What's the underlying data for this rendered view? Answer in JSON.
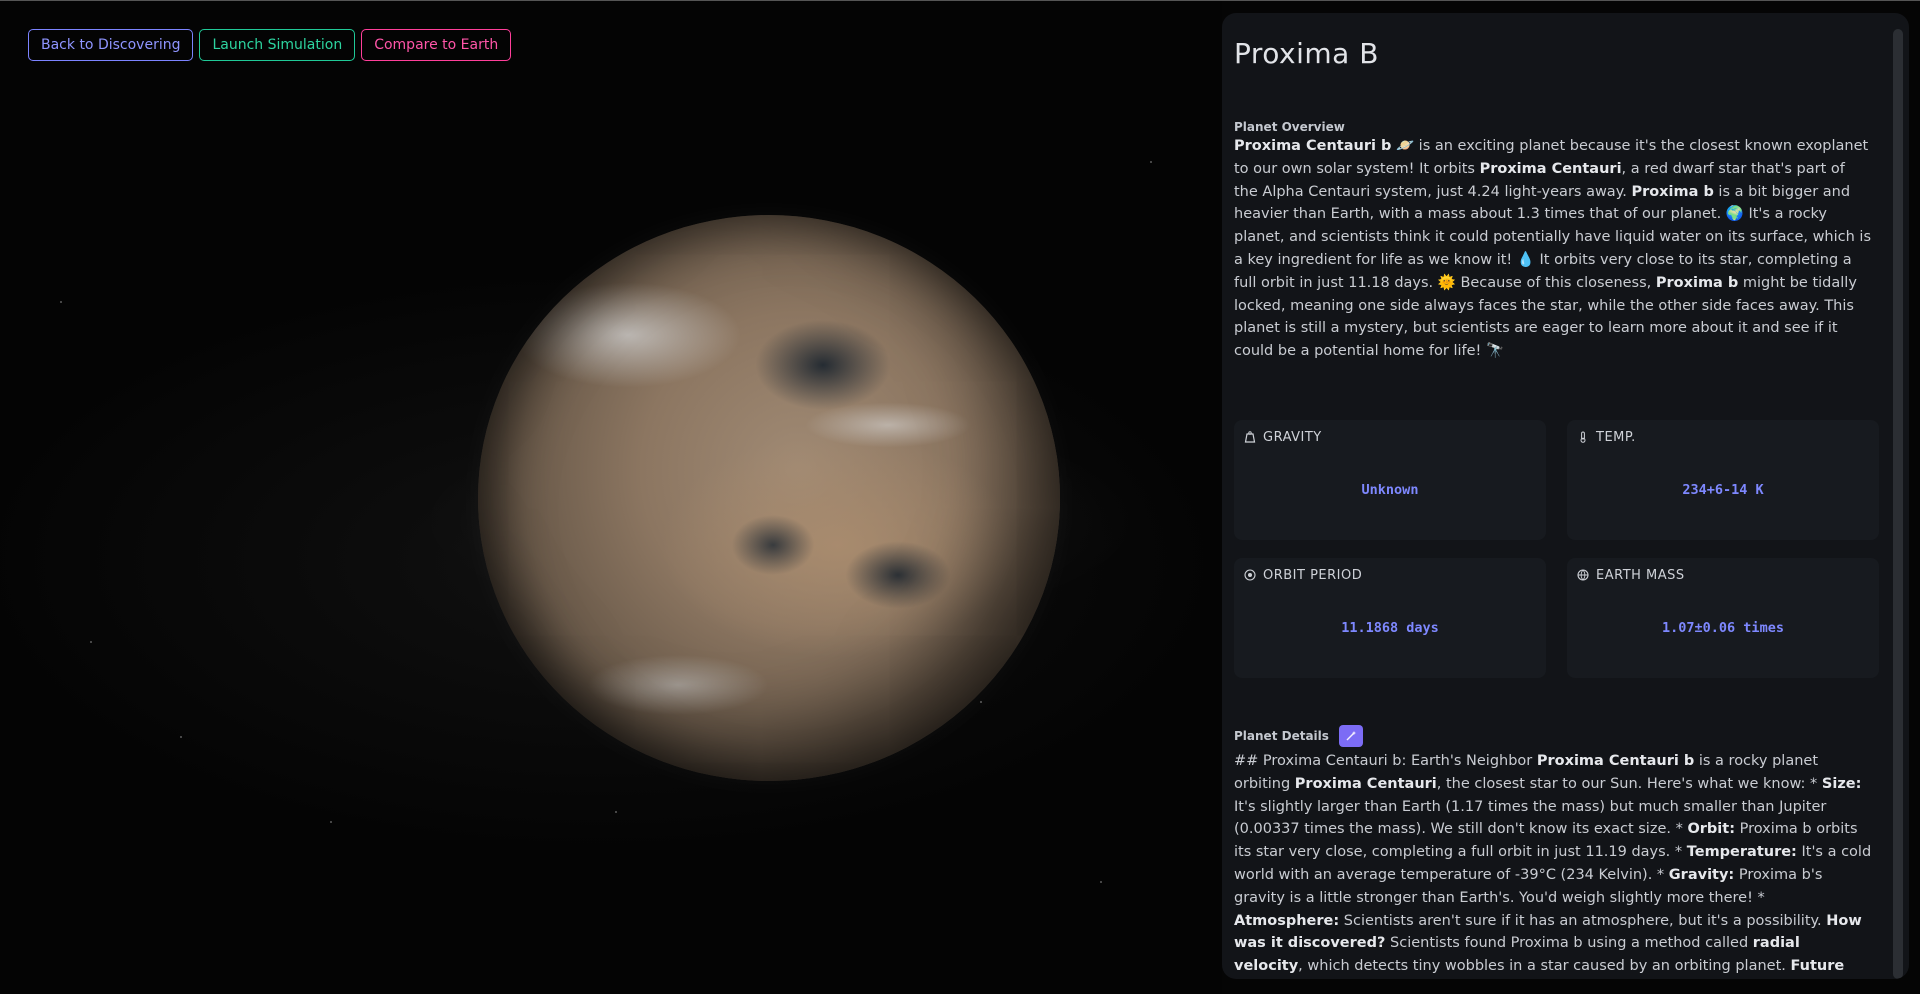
{
  "nav": {
    "back_label": "Back to Discovering",
    "launch_label": "Launch Simulation",
    "compare_label": "Compare to Earth"
  },
  "planet": {
    "name": "Proxima B"
  },
  "overview": {
    "title": "Planet Overview",
    "text_html": "<b>Proxima Centauri b</b> 🪐 is an exciting planet because it's the closest known exoplanet to our own solar system! It orbits <b>Proxima Centauri</b>, a red dwarf star that's part of the Alpha Centauri system, just 4.24 light-years away. <b>Proxima b</b> is a bit bigger and heavier than Earth, with a mass about 1.3 times that of our planet. 🌍 It's a rocky planet, and scientists think it could potentially have liquid water on its surface, which is a key ingredient for life as we know it! 💧 It orbits very close to its star, completing a full orbit in just 11.18 days. 🌞 Because of this closeness, <b>Proxima b</b> might be tidally locked, meaning one side always faces the star, while the other side faces away. This planet is still a mystery, but scientists are eager to learn more about it and see if it could be a potential home for life! 🔭"
  },
  "stats": {
    "gravity": {
      "label": "GRAVITY",
      "value": "Unknown",
      "icon": "weight-icon"
    },
    "temp": {
      "label": "TEMP.",
      "value": "234+6-14 K",
      "icon": "thermometer-icon"
    },
    "orbit": {
      "label": "ORBIT PERIOD",
      "value": "11.1868 days",
      "icon": "orbit-icon"
    },
    "mass": {
      "label": "EARTH MASS",
      "value": "1.07±0.06 times",
      "icon": "globe-icon"
    }
  },
  "details": {
    "title": "Planet Details",
    "text_html": "## Proxima Centauri b: Earth's Neighbor <b>Proxima Centauri b</b> is a rocky planet orbiting <b>Proxima Centauri</b>, the closest star to our Sun. Here's what we know: * <b>Size:</b> It's slightly larger than Earth (1.17 times the mass) but much smaller than Jupiter (0.00337 times the mass). We still don't know its exact size. * <b>Orbit:</b> Proxima b orbits its star very close, completing a full orbit in just 11.19 days. * <b>Temperature:</b> It's a cold world with an average temperature of -39°C (234 Kelvin). * <b>Gravity:</b> Proxima b's gravity is a little stronger than Earth's. You'd weigh slightly more there! * <b>Atmosphere:</b> Scientists aren't sure if it has an atmosphere, but it's a possibility. <b>How was it discovered?</b> Scientists found Proxima b using a method called <b>radial velocity</b>, which detects tiny wobbles in a star caused by an orbiting planet. <b>Future Research:</b> The <b>James Webb Space Telescope</b> could tell us more about Proxima b, including if it has an atmosphere and if it could support life."
  },
  "colors": {
    "background": "#050505",
    "panel": "#121418",
    "card": "#171a1f",
    "accent_value": "#7e88ff",
    "btn_blue": "#7c83ff",
    "btn_green": "#20c997",
    "btn_pink": "#ff3f9a"
  }
}
